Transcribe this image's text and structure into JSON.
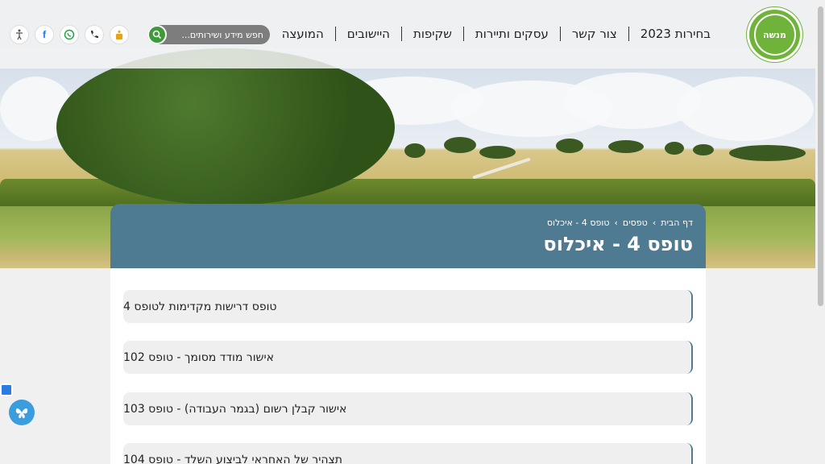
{
  "header": {
    "nav": [
      "המועצה",
      "היישובים",
      "שקיפות",
      "עסקים ותיירות",
      "צור קשר",
      "בחירות 2023"
    ],
    "search": {
      "placeholder": "חפש מידע ושירותים..."
    },
    "logo_text": "מנשה",
    "icons": [
      "accessibility-icon",
      "facebook-icon",
      "whatsapp-icon",
      "phone-icon",
      "badge-icon"
    ]
  },
  "breadcrumb": [
    "דף הבית",
    "טפסים",
    "טופס 4 - איכלוס"
  ],
  "breadcrumb_sep": "›",
  "page_title": "טופס 4 - איכלוס",
  "items": [
    "טופס דרישות מקדימות לטופס 4",
    "אישור מודד מסומך - טופס 102",
    "אישור קבלן רשום (בגמר העבודה) - טופס 103",
    "תצהיר של האחראי לביצוע השלד - טופס 104"
  ],
  "colors": {
    "primary": "#4e7a92",
    "green": "#6fb33a",
    "search": "#7d7d7d"
  }
}
